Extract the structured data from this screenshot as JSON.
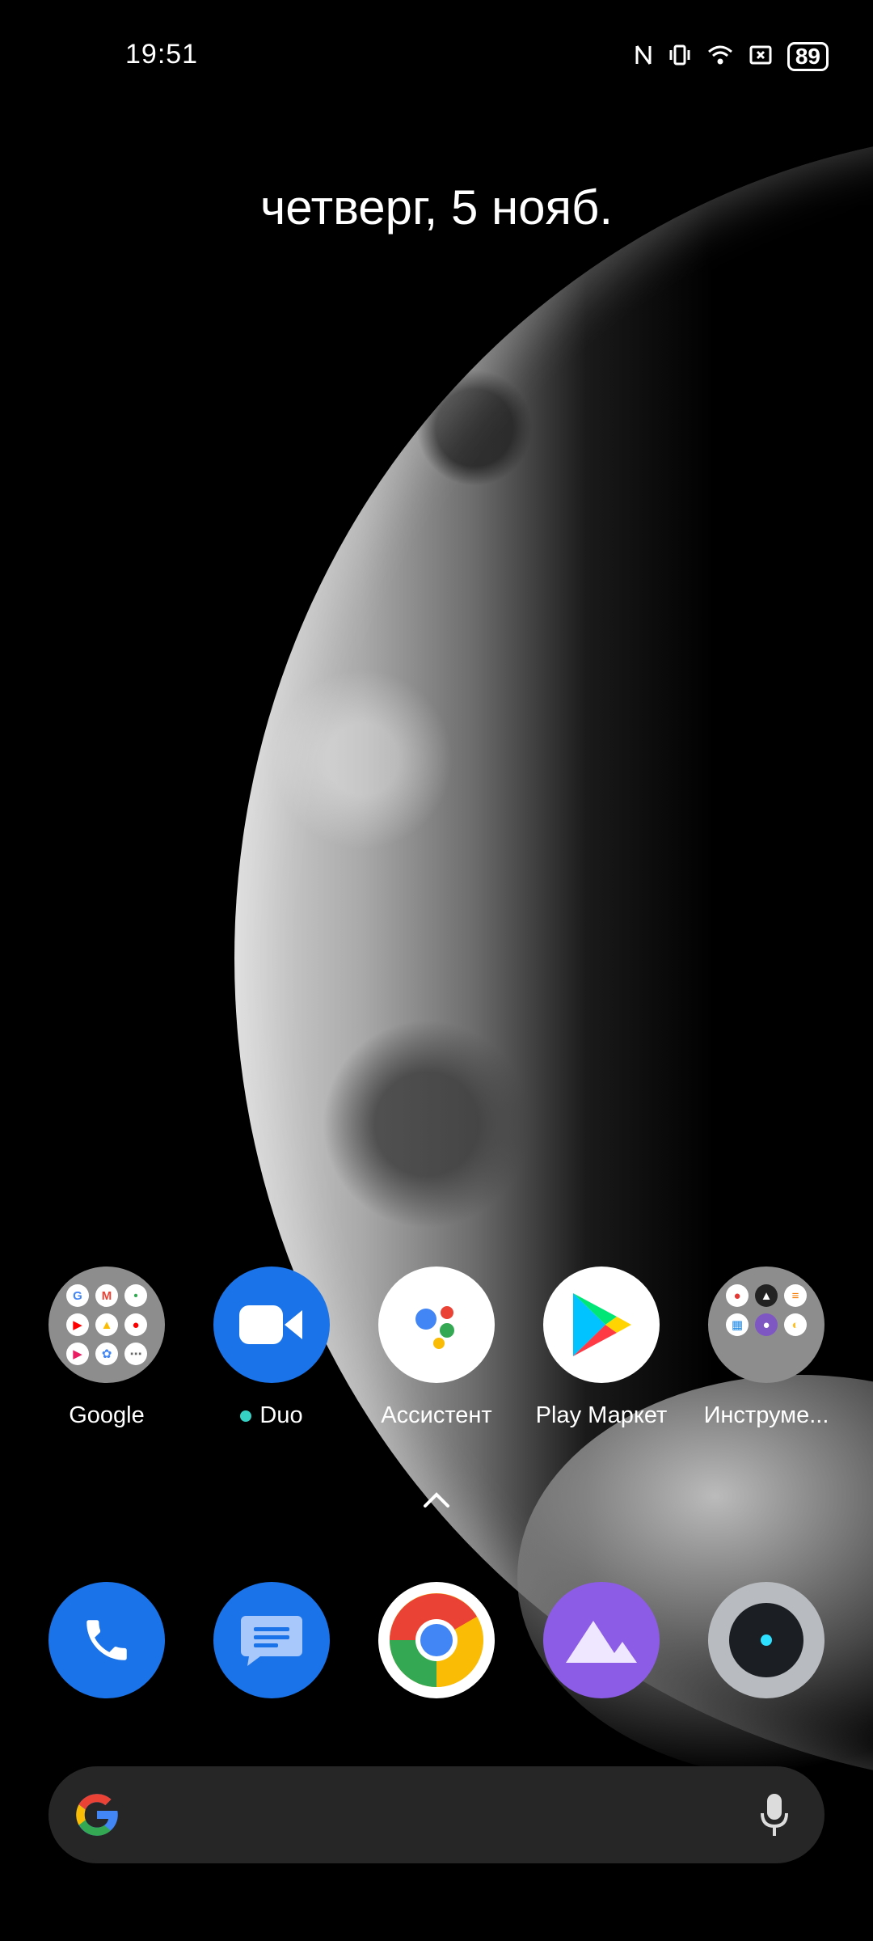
{
  "status_bar": {
    "time": "19:51",
    "icons": [
      "nfc-icon",
      "vibrate-icon",
      "wifi-icon",
      "screenshot-icon"
    ],
    "battery_level": "89"
  },
  "date_text": "четверг, 5 нояб.",
  "apps": [
    {
      "label": "Google"
    },
    {
      "label": "Duo"
    },
    {
      "label": "Ассистент"
    },
    {
      "label": "Play Маркет"
    },
    {
      "label": "Инструме..."
    }
  ],
  "dock": [
    "phone-icon",
    "messages-icon",
    "chrome-icon",
    "gallery-icon",
    "camera-icon"
  ],
  "colors": {
    "duo_blue": "#1a73e8",
    "assistant_white": "#ffffff",
    "messages_blue": "#1a73e8",
    "gallery_purple": "#8c5ce6",
    "camera_gray": "#b8bbbf",
    "search_bar_bg": "#262626"
  }
}
